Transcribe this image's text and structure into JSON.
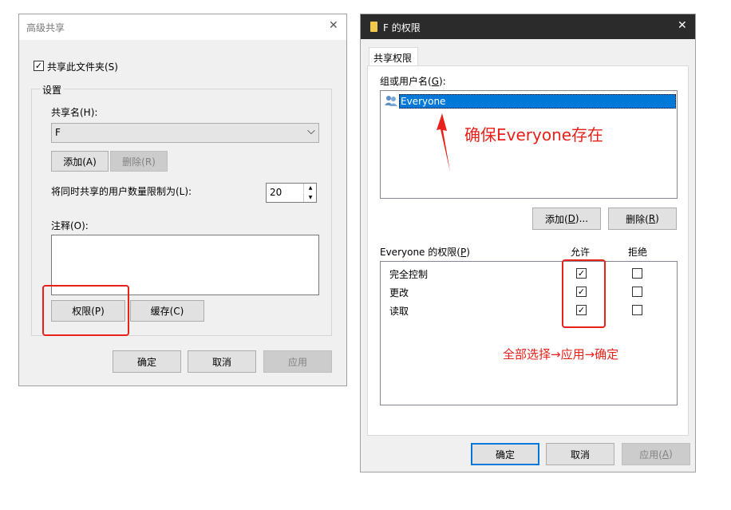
{
  "left_dialog": {
    "title": "高级共享",
    "close_glyph": "✕",
    "share_checkbox_label": "共享此文件夹(S)",
    "share_checked_glyph": "✓",
    "settings_group": "设置",
    "share_name_label": "共享名(H):",
    "share_name_value": "F",
    "dropdown_glyph": "⌵",
    "add_button": "添加(A)",
    "remove_button": "删除(R)",
    "user_limit_label": "将同时共享的用户数量限制为(L):",
    "user_limit_value": "20",
    "spin_up": "▲",
    "spin_down": "▼",
    "comment_label": "注释(O):",
    "permissions_button": "权限(P)",
    "cache_button": "缓存(C)",
    "ok_button": "确定",
    "cancel_button": "取消",
    "apply_button": "应用"
  },
  "right_dialog": {
    "title": "F 的权限",
    "close_glyph": "✕",
    "tab_label": "共享权限",
    "group_label_pre": "组或用户名(",
    "group_label_key": "G",
    "group_label_post": "):",
    "users": [
      "Everyone"
    ],
    "add_pre": "添加(",
    "add_key": "D",
    "add_post": ")...",
    "remove_pre": "删除(",
    "remove_key": "R",
    "remove_post": ")",
    "perm_label_pre": "Everyone 的权限(",
    "perm_label_key": "P",
    "perm_label_post": ")",
    "allow_header": "允许",
    "deny_header": "拒绝",
    "permissions": [
      {
        "name": "完全控制",
        "allow": true,
        "deny": false
      },
      {
        "name": "更改",
        "allow": true,
        "deny": false
      },
      {
        "name": "读取",
        "allow": true,
        "deny": false
      }
    ],
    "ok_button": "确定",
    "cancel_button": "取消",
    "apply_pre": "应用(",
    "apply_key": "A",
    "apply_post": ")"
  },
  "annotations": {
    "ensure_text": "确保Everyone存在",
    "select_all_text": "全部选择→应用→确定",
    "color": "#e8211a"
  },
  "colors": {
    "selection": "#0078d7",
    "title_dark": "#2b2b2b"
  }
}
